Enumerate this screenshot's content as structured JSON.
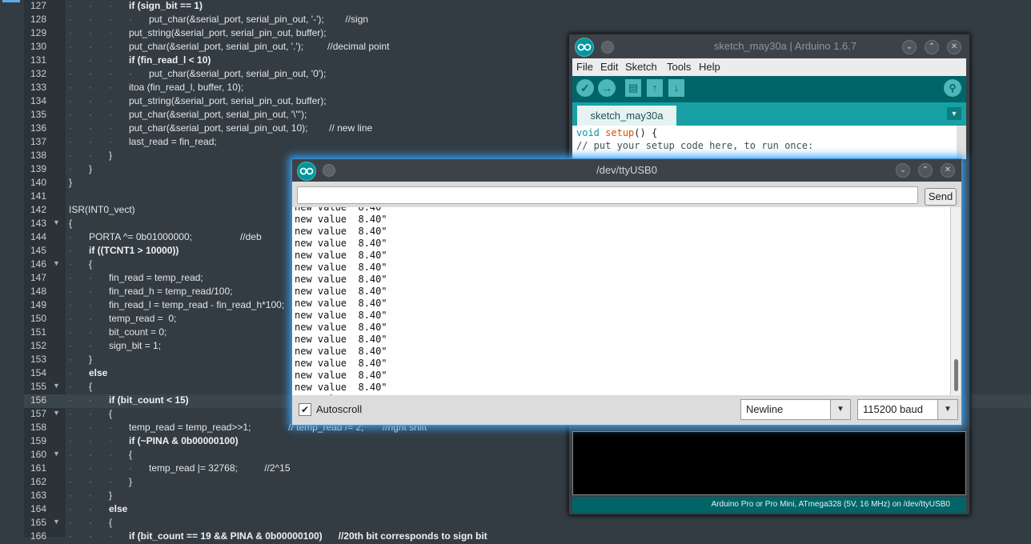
{
  "editor": {
    "lines": [
      {
        "num": "127",
        "text": "if (sign_bit == 1)"
      },
      {
        "num": "128",
        "text": "put_char(&serial_port, serial_pin_out, '-');        //sign"
      },
      {
        "num": "129",
        "text": "put_string(&serial_port, serial_pin_out, buffer);"
      },
      {
        "num": "130",
        "text": "put_char(&serial_port, serial_pin_out, '.');         //decimal point"
      },
      {
        "num": "131",
        "text": "if (fin_read_l < 10)"
      },
      {
        "num": "132",
        "text": "put_char(&serial_port, serial_pin_out, '0');"
      },
      {
        "num": "133",
        "text": "itoa (fin_read_l, buffer, 10);"
      },
      {
        "num": "134",
        "text": "put_string(&serial_port, serial_pin_out, buffer);"
      },
      {
        "num": "135",
        "text": "put_char(&serial_port, serial_pin_out, '\\\"');"
      },
      {
        "num": "136",
        "text": "put_char(&serial_port, serial_pin_out, 10);        // new line"
      },
      {
        "num": "137",
        "text": "last_read = fin_read;"
      },
      {
        "num": "138",
        "text": "}"
      },
      {
        "num": "139",
        "text": "}"
      },
      {
        "num": "140",
        "text": "}"
      },
      {
        "num": "141",
        "text": ""
      },
      {
        "num": "142",
        "text": "ISR(INT0_vect)"
      },
      {
        "num": "143",
        "text": "{"
      },
      {
        "num": "144",
        "text": "PORTA ^= 0b01000000;                  //deb"
      },
      {
        "num": "145",
        "text": "if ((TCNT1 > 10000))"
      },
      {
        "num": "146",
        "text": "{"
      },
      {
        "num": "147",
        "text": "fin_read = temp_read;"
      },
      {
        "num": "148",
        "text": "fin_read_h = temp_read/100;"
      },
      {
        "num": "149",
        "text": "fin_read_l = temp_read - fin_read_h*100;"
      },
      {
        "num": "150",
        "text": "temp_read =  0;"
      },
      {
        "num": "151",
        "text": "bit_count = 0;"
      },
      {
        "num": "152",
        "text": "sign_bit = 1;"
      },
      {
        "num": "153",
        "text": "}"
      },
      {
        "num": "154",
        "text": "else"
      },
      {
        "num": "155",
        "text": "{"
      },
      {
        "num": "156",
        "text": "if (bit_count < 15)"
      },
      {
        "num": "157",
        "text": "{"
      },
      {
        "num": "158",
        "text": "temp_read = temp_read>>1;              // temp_read /= 2;       //right shift"
      },
      {
        "num": "159",
        "text": "if (~PINA & 0b00000100)"
      },
      {
        "num": "160",
        "text": "{"
      },
      {
        "num": "161",
        "text": "temp_read |= 32768;          //2^15"
      },
      {
        "num": "162",
        "text": "}"
      },
      {
        "num": "163",
        "text": "}"
      },
      {
        "num": "164",
        "text": "else"
      },
      {
        "num": "165",
        "text": "{"
      },
      {
        "num": "166",
        "text": "if (bit_count == 19 && PINA & 0b00000100)      //20th bit corresponds to sign bit"
      }
    ]
  },
  "ide": {
    "title": "sketch_may30a | Arduino 1.6.7",
    "menus": [
      "File",
      "Edit",
      "Sketch",
      "Tools",
      "Help"
    ],
    "tab_label": "sketch_may30a",
    "code_line1_type": "void",
    "code_line1_fn": "setup",
    "code_line1_rest": "() {",
    "code_line2": "  // put your setup code here, to run once:",
    "status": "Arduino Pro or Pro Mini, ATmega328 (5V, 16 MHz) on /dev/ttyUSB0"
  },
  "serial": {
    "title": "/dev/ttyUSB0",
    "input_value": "",
    "send_label": "Send",
    "output_lines": [
      "new value  8.40\"",
      "new value  8.40\"",
      "new value  8.40\"",
      "new value  8.40\"",
      "new value  8.40\"",
      "new value  8.40\"",
      "new value  8.40\"",
      "new value  8.40\"",
      "new value  8.40\"",
      "new value  8.40\"",
      "new value  8.40\"",
      "new value  8.40\"",
      "new value  8.40\"",
      "new value  8.40\"",
      "new value  8.40\"",
      "new value  8.40\"",
      "new value"
    ],
    "autoscroll_label": "Autoscroll",
    "autoscroll_checked": true,
    "line_ending": "Newline",
    "baud": "115200 baud"
  }
}
